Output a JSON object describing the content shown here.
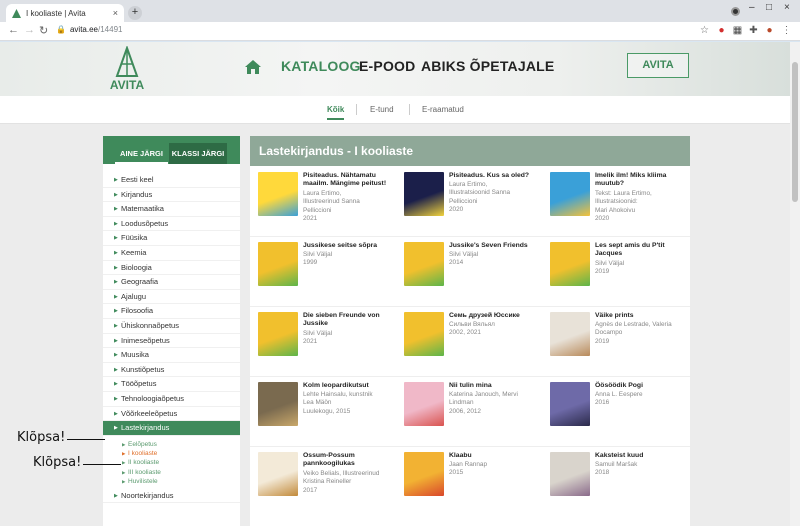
{
  "browser": {
    "tab_title": "I kooliaste | Avita",
    "tab_close": "×",
    "new_tab": "+",
    "url_host": "avita.ee",
    "url_path": "/14491",
    "minimize": "–",
    "maximize": "□",
    "close": "×"
  },
  "header": {
    "nav_kataloog": "KATALOOG",
    "nav_epood": "E-POOD",
    "nav_abiks": "ABIKS ÕPETAJALE",
    "avita_button": "AVITA",
    "logo_text": "AVITA"
  },
  "subnav": {
    "koik": "Kõik",
    "etund": "E-tund",
    "eraamatud": "E-raamatud"
  },
  "sidebar": {
    "tab_aine": "AINE JÄRGI",
    "tab_klassi": "KLASSI JÄRGI",
    "items": [
      "Eesti keel",
      "Kirjandus",
      "Matemaatika",
      "Loodusõpetus",
      "Füüsika",
      "Keemia",
      "Bioloogia",
      "Geograafia",
      "Ajalugu",
      "Filosoofia",
      "Ühiskonnaõpetus",
      "Inimeseõpetus",
      "Muusika",
      "Kunstiõpetus",
      "Tööõpetus",
      "Tehnoloogiaõpetus",
      "Võõrkeeleõpetus",
      "Lastekirjandus"
    ],
    "subitems": [
      "Eelõpetus",
      "I kooliaste",
      "II kooliaste",
      "III kooliaste",
      "Huvilistele"
    ],
    "last_item": "Noortekirjandus"
  },
  "annotations": {
    "click1": "Klõpsa!",
    "click2": "Klõpsa!"
  },
  "main": {
    "title": "Lastekirjandus - I kooliaste",
    "books": [
      {
        "title": "Pisiteadus. Nähtamatu maailm. Mängime peitust!",
        "meta": [
          "Laura Ertimo,",
          "Illustreerinud Sanna",
          "Pelliccioni",
          "2021"
        ]
      },
      {
        "title": "Pisiteadus. Kus sa oled?",
        "meta": [
          "Laura Ertimo,",
          "Illustratsioonid Sanna",
          "Pelliccioni",
          "2020"
        ]
      },
      {
        "title": "Imelik ilm! Miks kliima muutub?",
        "meta": [
          "Tekst: Laura Ertimo,",
          "Illustratsioonid:",
          "Mari Ahokoivu",
          "2020"
        ]
      },
      {
        "title": "Jussikese seitse sõpra",
        "meta": [
          "Silvi Väljal",
          "1999"
        ]
      },
      {
        "title": "Jussike's Seven Friends",
        "meta": [
          "Silvi Väljal",
          "2014"
        ]
      },
      {
        "title": "Les sept amis du P'tit Jacques",
        "meta": [
          "Silvi Väljal",
          "2019"
        ]
      },
      {
        "title": "Die sieben Freunde von Jussike",
        "meta": [
          "Silvi Väljal",
          "2021"
        ]
      },
      {
        "title": "Семь друзей Юссике",
        "meta": [
          "Сильви Вяльял",
          "2002, 2021"
        ]
      },
      {
        "title": "Väike prints",
        "meta": [
          "Agnès de Lestrade, Valeria",
          "Docampo",
          "2019"
        ]
      },
      {
        "title": "Kolm leopardikutsut",
        "meta": [
          "Lehte Hainsalu, kunstnik",
          "Lea Mäön",
          "Luulekogu, 2015"
        ]
      },
      {
        "title": "Nii tulin mina",
        "meta": [
          "Katerina Janouch, Mervi",
          "Lindman",
          "2006, 2012"
        ]
      },
      {
        "title": "Öösöödik Pogi",
        "meta": [
          "Anna L. Eespere",
          "2016"
        ]
      },
      {
        "title": "Ossum-Possum pannkoogilukas",
        "meta": [
          "Veiko Belials, Illustreerinud",
          "Kristina Reineller",
          "2017"
        ]
      },
      {
        "title": "Klaabu",
        "meta": [
          "Jaan Rannap",
          "2015"
        ]
      },
      {
        "title": "Kaksteist kuud",
        "meta": [
          "Samuil Maršak",
          "2018"
        ]
      }
    ]
  },
  "colors": {
    "brand_green": "#3f8a5b",
    "header_bar": "#8fa898",
    "current_orange": "#e0702b"
  }
}
